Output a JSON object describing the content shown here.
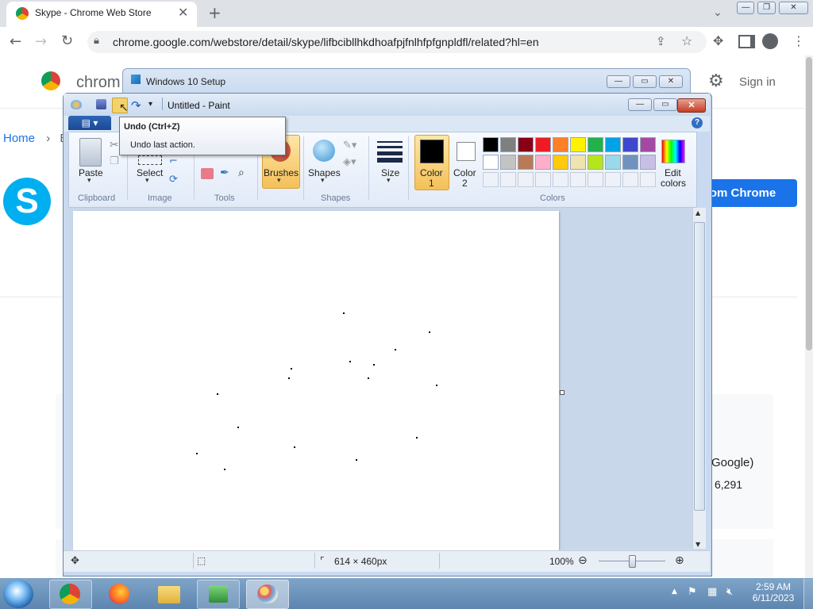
{
  "browser": {
    "tab_title": "Skype - Chrome Web Store",
    "tab_close": "✕",
    "new_tab": "+",
    "url": "chrome.google.com/webstore/detail/skype/lifbcibllhkdhoafpjfnlhfpfgnpldfl/related?hl=en",
    "window_controls": [
      "—",
      "❐",
      "✕"
    ]
  },
  "webstore": {
    "header_title": "chrom",
    "sign_in": "Sign in",
    "breadcrumb_home": "Home",
    "breadcrumb_sep": "›",
    "breadcrumb_next": "E",
    "add_button": "rom Chrome",
    "right_text_1": "Google)",
    "right_text_2": "6,291"
  },
  "setup_window": {
    "title": "Windows 10 Setup"
  },
  "paint": {
    "title": "Untitled - Paint",
    "file_tab": "▤ ▾",
    "help": "?",
    "ribbon": {
      "paste": "Paste",
      "clipboard": "Clipboard",
      "select": "Select",
      "image": "Image",
      "tools": "Tools",
      "brushes": "Brushes",
      "shapes_btn": "Shapes",
      "shapes_group": "Shapes",
      "size": "Size",
      "color1": "Color\n1",
      "color1_a": "Color",
      "color1_b": "1",
      "color2_a": "Color",
      "color2_b": "2",
      "edit_colors_a": "Edit",
      "edit_colors_b": "colors",
      "colors_group": "Colors"
    },
    "palette_row1": [
      "#000000",
      "#7f7f7f",
      "#880015",
      "#ed1c24",
      "#ff7f27",
      "#fff200",
      "#22b14c",
      "#00a2e8",
      "#3f48cc",
      "#a349a4"
    ],
    "palette_row2": [
      "#ffffff",
      "#c3c3c3",
      "#b97a57",
      "#ffaec9",
      "#ffc90e",
      "#efe4b0",
      "#b5e61d",
      "#99d9ea",
      "#7092be",
      "#c8bfe7"
    ],
    "color1_value": "#000000",
    "color2_value": "#ffffff",
    "status": {
      "dimensions": "614 × 460px",
      "zoom": "100%"
    }
  },
  "tooltip": {
    "title": "Undo (Ctrl+Z)",
    "description": "Undo last action."
  },
  "taskbar": {
    "time": "2:59 AM",
    "date": "6/11/2023"
  }
}
